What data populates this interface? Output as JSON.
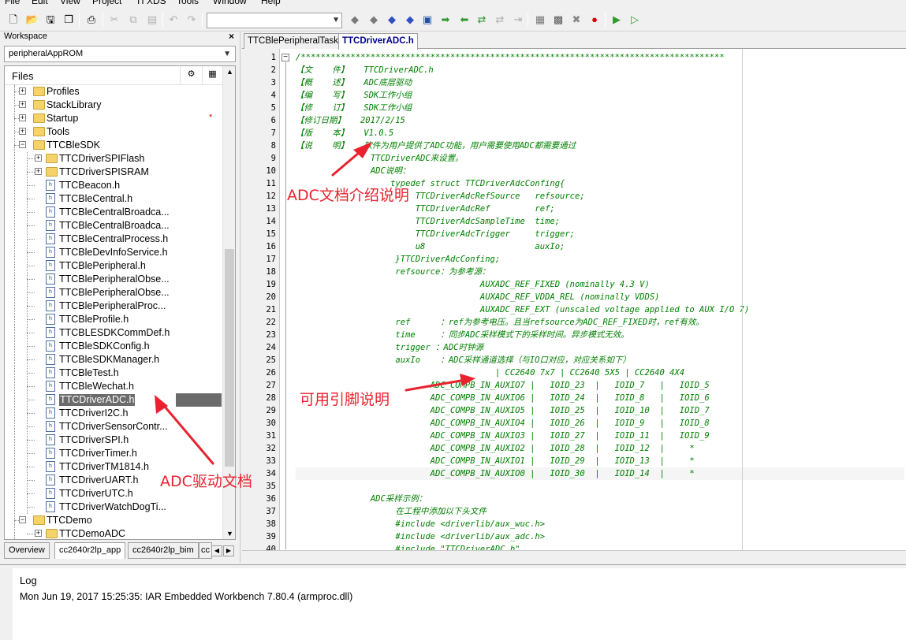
{
  "menu": [
    "File",
    "Edit",
    "View",
    "Project",
    "TI XDS",
    "Tools",
    "Window",
    "Help"
  ],
  "toolbar": {
    "icons": [
      "new-file-icon",
      "open-icon",
      "save-icon",
      "save-all-icon",
      "print-icon",
      "cut-icon",
      "copy-icon",
      "paste-icon",
      "undo-icon",
      "redo-icon",
      "find-combo",
      "toggle-bookmark-icon",
      "go-to-bookmark-icon",
      "next-bookmark-icon",
      "previous-bookmark-icon",
      "go-to-definition-icon",
      "navigate-forward-icon",
      "navigate-back-icon",
      "go-to-line-icon",
      "compile-icon",
      "make-icon",
      "stop-build-icon",
      "toggle-breakpoint-icon",
      "download-debug-icon",
      "debug-without-download-icon"
    ]
  },
  "workspace": {
    "title": "Workspace",
    "close": "×",
    "config": "peripheralAppROM",
    "files_header": "Files",
    "tree": [
      {
        "label": "Profiles",
        "kind": "folder",
        "level": 1,
        "exp": "+"
      },
      {
        "label": "StackLibrary",
        "kind": "folder",
        "level": 1,
        "exp": "+"
      },
      {
        "label": "Startup",
        "kind": "folder",
        "level": 1,
        "exp": "+",
        "mark": "*"
      },
      {
        "label": "Tools",
        "kind": "folder",
        "level": 1,
        "exp": "+"
      },
      {
        "label": "TTCBleSDK",
        "kind": "folder",
        "level": 1,
        "exp": "-"
      },
      {
        "label": "TTCDriverSPIFlash",
        "kind": "folder",
        "level": 2,
        "exp": "+"
      },
      {
        "label": "TTCDriverSPISRAM",
        "kind": "folder",
        "level": 2,
        "exp": "+"
      },
      {
        "label": "TTCBeacon.h",
        "kind": "file",
        "level": 2
      },
      {
        "label": "TTCBleCentral.h",
        "kind": "file",
        "level": 2
      },
      {
        "label": "TTCBleCentralBroadca...",
        "kind": "file",
        "level": 2
      },
      {
        "label": "TTCBleCentralBroadca...",
        "kind": "file",
        "level": 2
      },
      {
        "label": "TTCBleCentralProcess.h",
        "kind": "file",
        "level": 2
      },
      {
        "label": "TTCBleDevInfoService.h",
        "kind": "file",
        "level": 2
      },
      {
        "label": "TTCBlePeripheral.h",
        "kind": "file",
        "level": 2
      },
      {
        "label": "TTCBlePeripheralObse...",
        "kind": "file",
        "level": 2
      },
      {
        "label": "TTCBlePeripheralObse...",
        "kind": "file",
        "level": 2
      },
      {
        "label": "TTCBlePeripheralProc...",
        "kind": "file",
        "level": 2
      },
      {
        "label": "TTCBleProfile.h",
        "kind": "file",
        "level": 2
      },
      {
        "label": "TTCBLESDKCommDef.h",
        "kind": "file",
        "level": 2
      },
      {
        "label": "TTCBleSDKConfig.h",
        "kind": "file",
        "level": 2
      },
      {
        "label": "TTCBleSDKManager.h",
        "kind": "file",
        "level": 2
      },
      {
        "label": "TTCBleTest.h",
        "kind": "file",
        "level": 2
      },
      {
        "label": "TTCBleWechat.h",
        "kind": "file",
        "level": 2
      },
      {
        "label": "TTCDriverADC.h",
        "kind": "file",
        "level": 2,
        "selected": true
      },
      {
        "label": "TTCDriverI2C.h",
        "kind": "file",
        "level": 2
      },
      {
        "label": "TTCDriverSensorContr...",
        "kind": "file",
        "level": 2
      },
      {
        "label": "TTCDriverSPI.h",
        "kind": "file",
        "level": 2
      },
      {
        "label": "TTCDriverTimer.h",
        "kind": "file",
        "level": 2
      },
      {
        "label": "TTCDriverTM1814.h",
        "kind": "file",
        "level": 2
      },
      {
        "label": "TTCDriverUART.h",
        "kind": "file",
        "level": 2
      },
      {
        "label": "TTCDriverUTC.h",
        "kind": "file",
        "level": 2
      },
      {
        "label": "TTCDriverWatchDogTi...",
        "kind": "file",
        "level": 2
      },
      {
        "label": "TTCDemo",
        "kind": "folder",
        "level": 1,
        "exp": "-"
      },
      {
        "label": "TTCDemoADC",
        "kind": "folder",
        "level": 2,
        "exp": "+"
      }
    ],
    "tabs": [
      "Overview",
      "cc2640r2lp_app",
      "cc2640r2lp_bim",
      "cc"
    ]
  },
  "editor": {
    "tabs": [
      "TTCBlePeripheralTask.c",
      "TTCDriverADC.h"
    ],
    "active_tab": 1,
    "lines": [
      "/*************************************************************************************",
      "【文    件】   TTCDriverADC.h",
      "【概    述】   ADC底层驱动",
      "【编    写】   SDK工作小组",
      "【修    订】   SDK工作小组",
      "【修订日期】   2017/2/15",
      "【版    本】   V1.0.5",
      "【说    明】   软件为用户提供了ADC功能，用户需要使用ADC都需要通过",
      "               TTCDriverADC来设置。",
      "               ADC说明：",
      "                   typedef struct TTCDriverAdcConfing{",
      "                        TTCDriverAdcRefSource   refsource;",
      "                        TTCDriverAdcRef         ref;",
      "                        TTCDriverAdcSampleTime  time;",
      "                        TTCDriverAdcTrigger     trigger;",
      "                        u8                      auxIo;",
      "                    }TTCDriverAdcConfing;",
      "                    refsource：为参考源：",
      "                                     AUXADC_REF_FIXED (nominally 4.3 V)",
      "                                     AUXADC_REF_VDDA_REL (nominally VDDS)",
      "                                     AUXADC_REF_EXT (unscaled voltage applied to AUX I/O 7)",
      "                    ref      ：ref为参考电压。且当refsource为ADC_REF_FIXED时，ref有效。",
      "                    time     ：同步ADC采样模式下的采样时间。异步模式无效。",
      "                    trigger ：ADC时钟源",
      "                    auxIo    ：ADC采样通道选择（与IO口对应，对应关系如下）",
      "                                        | CC2640 7x7 | CC2640 5X5 | CC2640 4X4",
      "                           ADC_COMPB_IN_AUXIO7 |   IOID_23  |   IOID_7   |   IOID_5",
      "                           ADC_COMPB_IN_AUXIO6 |   IOID_24  |   IOID_8   |   IOID_6",
      "                           ADC_COMPB_IN_AUXIO5 |   IOID_25  |   IOID_10  |   IOID_7",
      "                           ADC_COMPB_IN_AUXIO4 |   IOID_26  |   IOID_9   |   IOID_8",
      "                           ADC_COMPB_IN_AUXIO3 |   IOID_27  |   IOID_11  |   IOID_9",
      "                           ADC_COMPB_IN_AUXIO2 |   IOID_28  |   IOID_12  |     *",
      "                           ADC_COMPB_IN_AUXIO1 |   IOID_29  |   IOID_13  |     *",
      "                           ADC_COMPB_IN_AUXIO0 |   IOID_30  |   IOID_14  |     *",
      "",
      "               ADC采样示例：",
      "                    在工程中添加以下头文件",
      "                    #include <driverlib/aux_wuc.h>",
      "                    #include <driverlib/aux_adc.h>",
      "                    #include \"TTCDriverADC.h\""
    ],
    "line_numbers": [
      "1",
      "2",
      "3",
      "4",
      "5",
      "6",
      "7",
      "8",
      "9",
      "10",
      "11",
      "12",
      "13",
      "14",
      "15",
      "16",
      "17",
      "18",
      "19",
      "20",
      "21",
      "22",
      "23",
      "24",
      "25",
      "26",
      "27",
      "28",
      "29",
      "30",
      "31",
      "32",
      "33",
      "34",
      "35",
      "36",
      "37",
      "38",
      "39",
      "40"
    ],
    "current_line": 34
  },
  "log": {
    "header": "Log",
    "entry": "Mon Jun 19, 2017 15:25:35: IAR Embedded Workbench 7.80.4 (armproc.dll)"
  },
  "annotations": {
    "doc_intro": "ADC文档介绍说明",
    "pins": "可用引脚说明",
    "driver_doc": "ADC驱动文档",
    "color": "#e8232f"
  }
}
